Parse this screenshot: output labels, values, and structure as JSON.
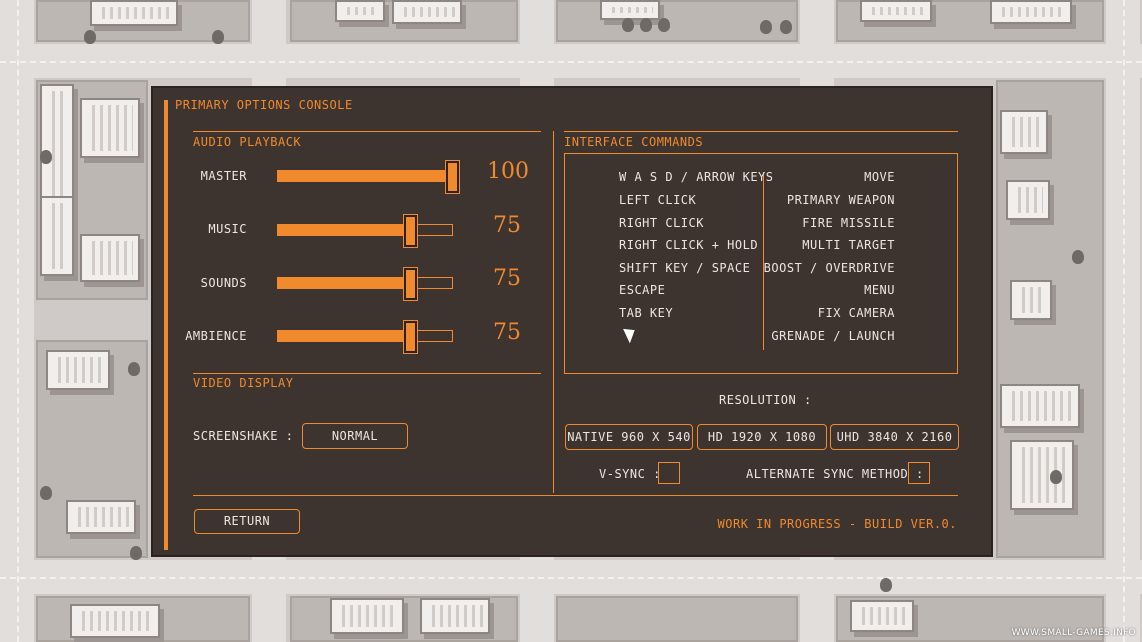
{
  "panel": {
    "title": "PRIMARY OPTIONS CONSOLE",
    "accent_color": "#f08a2c",
    "background_color": "#3d332f"
  },
  "audio": {
    "title": "AUDIO PLAYBACK",
    "sliders": [
      {
        "label": "MASTER",
        "value": 100,
        "value_text": "100"
      },
      {
        "label": "MUSIC",
        "value": 75,
        "value_text": "75"
      },
      {
        "label": "SOUNDS",
        "value": 75,
        "value_text": "75"
      },
      {
        "label": "AMBIENCE",
        "value": 75,
        "value_text": "75"
      }
    ]
  },
  "video": {
    "title": "VIDEO DISPLAY",
    "screenshake_label": "SCREENSHAKE  :",
    "screenshake_value": "NORMAL"
  },
  "interface": {
    "title": "INTERFACE COMMANDS",
    "commands": [
      {
        "key": "W A S D / ARROW KEYS",
        "action": "MOVE"
      },
      {
        "key": "LEFT CLICK",
        "action": "PRIMARY WEAPON"
      },
      {
        "key": "RIGHT CLICK",
        "action": "FIRE MISSILE"
      },
      {
        "key": "RIGHT CLICK + HOLD",
        "action": "MULTI TARGET"
      },
      {
        "key": "SHIFT KEY / SPACE",
        "action": "BOOST / OVERDRIVE"
      },
      {
        "key": "ESCAPE",
        "action": "MENU"
      },
      {
        "key": "TAB KEY",
        "action": "FIX CAMERA"
      },
      {
        "key": "",
        "action": "GRENADE / LAUNCH"
      }
    ]
  },
  "resolution": {
    "label": "RESOLUTION :",
    "options": [
      "NATIVE 960 X 540",
      "HD 1920 X 1080",
      "UHD 3840 X 2160"
    ],
    "vsync_label": "V-SYNC :",
    "alt_sync_label": "ALTERNATE SYNC METHOD :"
  },
  "footer": {
    "return_label": "RETURN",
    "build_text": "WORK IN PROGRESS - BUILD VER.0."
  },
  "watermark": "WWW.SMALL-GAMES.INFO"
}
